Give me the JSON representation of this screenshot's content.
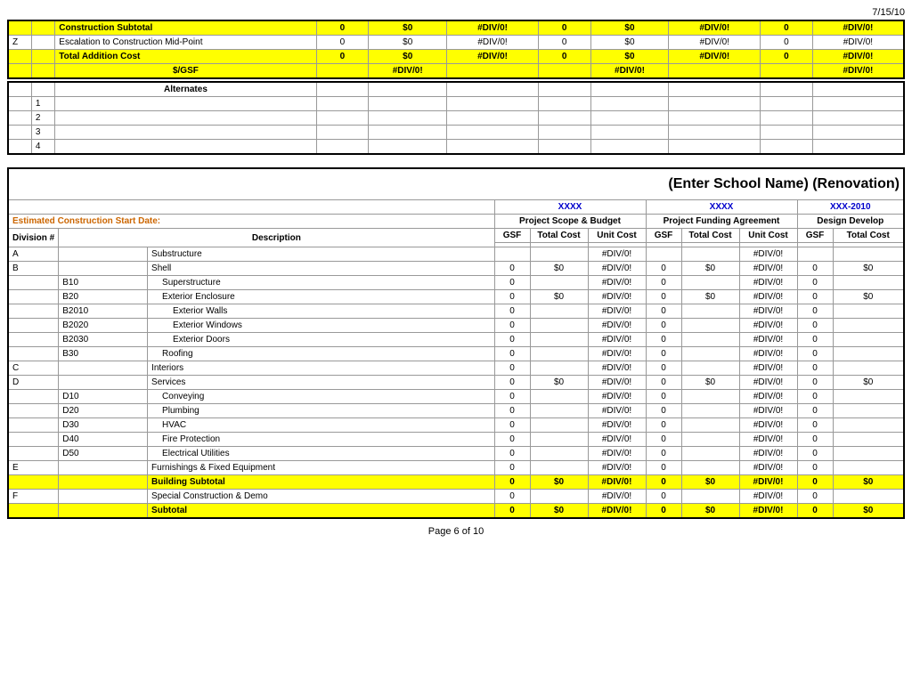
{
  "date": "7/15/10",
  "page": "Page 6 of 10",
  "top_section": {
    "rows": [
      {
        "label": "Construction Subtotal",
        "is_header": true,
        "yellow": true,
        "gsf1": "0",
        "tc1": "$0",
        "uc1": "#DIV/0!",
        "gsf2": "0",
        "tc2": "$0",
        "uc2": "#DIV/0!",
        "gsf3": "0",
        "uc3": "#DIV/0!"
      },
      {
        "code": "Z",
        "label": "Escalation to Construction Mid-Point",
        "yellow": false,
        "gsf1": "0",
        "tc1": "$0",
        "uc1": "#DIV/0!",
        "gsf2": "0",
        "tc2": "$0",
        "uc2": "#DIV/0!",
        "gsf3": "0",
        "uc3": "#DIV/0!"
      }
    ],
    "total_row": {
      "label": "Total Addition Cost",
      "gsf_label": "$/GSF",
      "gsf1": "0",
      "tc1": "$0",
      "uc1": "#DIV/0!",
      "gsf2": "0",
      "tc2": "$0",
      "uc2": "#DIV/0!",
      "gsf3": "0",
      "uc3": "#DIV/0!"
    }
  },
  "alternates": {
    "header": "Alternates",
    "rows": [
      "1",
      "2",
      "3",
      "4"
    ]
  },
  "school_title": "(Enter School Name) (Renovation)",
  "est_start_label": "Estimated Construction Start Date:",
  "col1_header": "XXXX",
  "col2_header": "XXXX",
  "col3_header": "XXX-2010",
  "sections": {
    "scope_budget": "Project Scope & Budget",
    "funding_agreement": "Project Funding Agreement",
    "design_develop": "Design Develop"
  },
  "col_headers": {
    "gsf": "GSF",
    "total_cost": "Total Cost",
    "unit_cost": "Unit Cost"
  },
  "division_label": "Division #",
  "description_label": "Description",
  "rows": [
    {
      "div": "A",
      "code": "",
      "label": "Substructure",
      "gsf1": "",
      "tc1": "",
      "uc1": "#DIV/0!",
      "gsf2": "",
      "tc2": "",
      "uc2": "#DIV/0!",
      "gsf3": "",
      "tc3": ""
    },
    {
      "div": "B",
      "code": "",
      "label": "Shell",
      "gsf1": "0",
      "tc1": "$0",
      "uc1": "#DIV/0!",
      "gsf2": "0",
      "tc2": "$0",
      "uc2": "#DIV/0!",
      "gsf3": "0",
      "tc3": "$0"
    },
    {
      "div": "",
      "code": "B10",
      "label": "Superstructure",
      "gsf1": "0",
      "tc1": "",
      "uc1": "#DIV/0!",
      "gsf2": "0",
      "tc2": "",
      "uc2": "#DIV/0!",
      "gsf3": "0",
      "tc3": ""
    },
    {
      "div": "",
      "code": "B20",
      "label": "Exterior Enclosure",
      "gsf1": "0",
      "tc1": "$0",
      "uc1": "#DIV/0!",
      "gsf2": "0",
      "tc2": "$0",
      "uc2": "#DIV/0!",
      "gsf3": "0",
      "tc3": "$0"
    },
    {
      "div": "",
      "code": "B2010",
      "label": "Exterior Walls",
      "gsf1": "0",
      "tc1": "",
      "uc1": "#DIV/0!",
      "gsf2": "0",
      "tc2": "",
      "uc2": "#DIV/0!",
      "gsf3": "0",
      "tc3": ""
    },
    {
      "div": "",
      "code": "B2020",
      "label": "Exterior Windows",
      "gsf1": "0",
      "tc1": "",
      "uc1": "#DIV/0!",
      "gsf2": "0",
      "tc2": "",
      "uc2": "#DIV/0!",
      "gsf3": "0",
      "tc3": ""
    },
    {
      "div": "",
      "code": "B2030",
      "label": "Exterior Doors",
      "gsf1": "0",
      "tc1": "",
      "uc1": "#DIV/0!",
      "gsf2": "0",
      "tc2": "",
      "uc2": "#DIV/0!",
      "gsf3": "0",
      "tc3": ""
    },
    {
      "div": "",
      "code": "B30",
      "label": "Roofing",
      "gsf1": "0",
      "tc1": "",
      "uc1": "#DIV/0!",
      "gsf2": "0",
      "tc2": "",
      "uc2": "#DIV/0!",
      "gsf3": "0",
      "tc3": ""
    },
    {
      "div": "C",
      "code": "",
      "label": "Interiors",
      "gsf1": "0",
      "tc1": "",
      "uc1": "#DIV/0!",
      "gsf2": "0",
      "tc2": "",
      "uc2": "#DIV/0!",
      "gsf3": "0",
      "tc3": ""
    },
    {
      "div": "D",
      "code": "",
      "label": "Services",
      "gsf1": "0",
      "tc1": "$0",
      "uc1": "#DIV/0!",
      "gsf2": "0",
      "tc2": "$0",
      "uc2": "#DIV/0!",
      "gsf3": "0",
      "tc3": "$0"
    },
    {
      "div": "",
      "code": "D10",
      "label": "Conveying",
      "gsf1": "0",
      "tc1": "",
      "uc1": "#DIV/0!",
      "gsf2": "0",
      "tc2": "",
      "uc2": "#DIV/0!",
      "gsf3": "0",
      "tc3": ""
    },
    {
      "div": "",
      "code": "D20",
      "label": "Plumbing",
      "gsf1": "0",
      "tc1": "",
      "uc1": "#DIV/0!",
      "gsf2": "0",
      "tc2": "",
      "uc2": "#DIV/0!",
      "gsf3": "0",
      "tc3": ""
    },
    {
      "div": "",
      "code": "D30",
      "label": "HVAC",
      "gsf1": "0",
      "tc1": "",
      "uc1": "#DIV/0!",
      "gsf2": "0",
      "tc2": "",
      "uc2": "#DIV/0!",
      "gsf3": "0",
      "tc3": ""
    },
    {
      "div": "",
      "code": "D40",
      "label": "Fire Protection",
      "gsf1": "0",
      "tc1": "",
      "uc1": "#DIV/0!",
      "gsf2": "0",
      "tc2": "",
      "uc2": "#DIV/0!",
      "gsf3": "0",
      "tc3": ""
    },
    {
      "div": "",
      "code": "D50",
      "label": "Electrical Utilities",
      "gsf1": "0",
      "tc1": "",
      "uc1": "#DIV/0!",
      "gsf2": "0",
      "tc2": "",
      "uc2": "#DIV/0!",
      "gsf3": "0",
      "tc3": ""
    },
    {
      "div": "E",
      "code": "",
      "label": "Furnishings & Fixed Equipment",
      "gsf1": "0",
      "tc1": "",
      "uc1": "#DIV/0!",
      "gsf2": "0",
      "tc2": "",
      "uc2": "#DIV/0!",
      "gsf3": "0",
      "tc3": ""
    }
  ],
  "building_subtotal": {
    "label": "Building Subtotal",
    "gsf1": "0",
    "tc1": "$0",
    "uc1": "#DIV/0!",
    "gsf2": "0",
    "tc2": "$0",
    "uc2": "#DIV/0!",
    "gsf3": "0",
    "tc3": "$0"
  },
  "special_row": {
    "div": "F",
    "label": "Special Construction & Demo",
    "gsf1": "0",
    "tc1": "",
    "uc1": "#DIV/0!",
    "gsf2": "0",
    "tc2": "",
    "uc2": "#DIV/0!",
    "gsf3": "0",
    "tc3": ""
  },
  "subtotal_row": {
    "label": "Subtotal",
    "gsf1": "0",
    "tc1": "$0",
    "uc1": "#DIV/0!",
    "gsf2": "0",
    "tc2": "$0",
    "uc2": "#DIV/0!",
    "gsf3": "0",
    "tc3": "$0"
  }
}
